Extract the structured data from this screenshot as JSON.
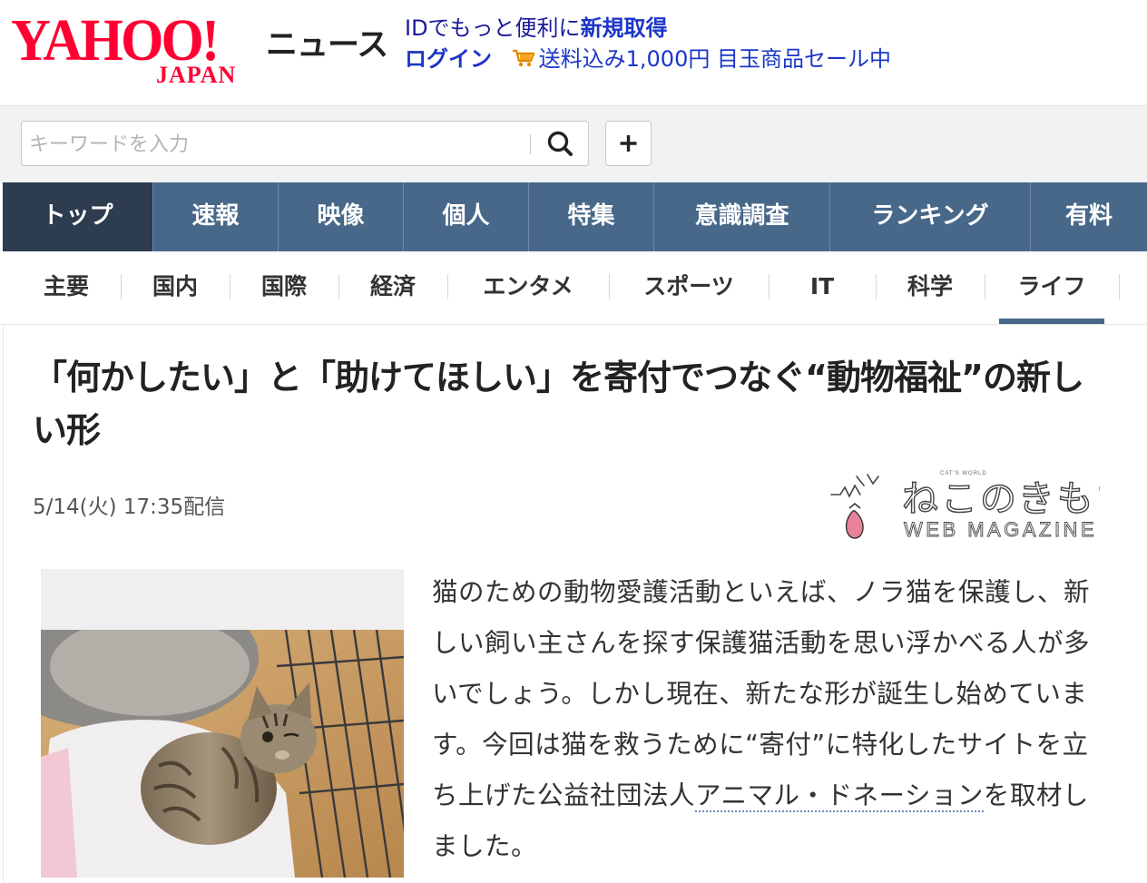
{
  "header": {
    "logo_text": "YAHOO!",
    "logo_subtext": "JAPAN",
    "service_name": "ニュース",
    "promo": {
      "line1_prefix": "IDでもっと便利に",
      "line1_link": "新規取得",
      "login_link": "ログイン",
      "cart_icon": "shopping-cart-icon",
      "sale_text": "送料込み1,000円 目玉商品セール中"
    }
  },
  "search": {
    "placeholder": "キーワードを入力",
    "search_icon": "magnifier",
    "add_label": "+"
  },
  "main_nav": {
    "tabs": [
      {
        "label": "トップ",
        "active": true
      },
      {
        "label": "速報"
      },
      {
        "label": "映像"
      },
      {
        "label": "個人"
      },
      {
        "label": "特集"
      },
      {
        "label": "意識調査"
      },
      {
        "label": "ランキング"
      },
      {
        "label": "有料"
      }
    ]
  },
  "sub_nav": {
    "tabs": [
      {
        "label": "主要"
      },
      {
        "label": "国内"
      },
      {
        "label": "国際"
      },
      {
        "label": "経済"
      },
      {
        "label": "エンタメ"
      },
      {
        "label": "スポーツ"
      },
      {
        "label": "IT"
      },
      {
        "label": "科学"
      },
      {
        "label": "ライフ",
        "active": true
      }
    ]
  },
  "article": {
    "headline": "「何かしたい」と「助けてほしい」を寄付でつなぐ“動物福祉”の新しい形",
    "date": "5/14(火) 17:35配信",
    "source": {
      "logo_name": "ねこのきもち",
      "logo_small": "CAT'S WORLD",
      "logo_sub": "WEB MAGAZINE"
    },
    "photo_alt": "cat photo",
    "body_pre": "猫のための動物愛護活動といえば、ノラ猫を保護し、新しい飼い主さんを探す保護猫活動を思い浮かべる人が多いでしょう。しかし現在、新たな形が誕生し始めています。今回は猫を救うために“寄付”に特化したサイトを立ち上げた公益社団法人",
    "body_link": "アニマル・ドネーション",
    "body_post": "を取材しました。"
  },
  "colors": {
    "brand_red": "#ff0033",
    "nav_blue": "#476889",
    "nav_active": "#2d3c4e",
    "link_blue": "#1b36c8"
  }
}
